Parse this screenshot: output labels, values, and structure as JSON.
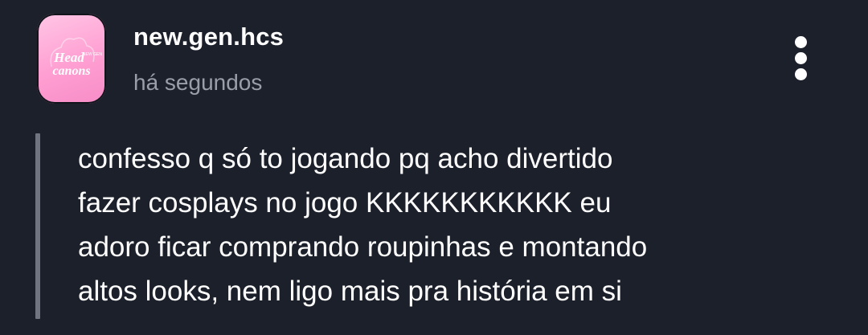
{
  "post": {
    "author": "new.gen.hcs",
    "timestamp": "há segundos",
    "avatar": {
      "logo_top": "Head",
      "logo_bottom": "canons",
      "logo_small": "NEW GEN",
      "colors": {
        "bg": "#ff9fd2",
        "text": "#ffffff"
      }
    },
    "more_icon": "vertical-ellipsis-icon",
    "quote_lines": [
      "confesso q só to jogando pq acho divertido",
      "fazer cosplays no jogo KKKKKKKKKKK eu",
      "adoro ficar comprando roupinhas e montando",
      "altos looks, nem ligo mais pra história em si"
    ]
  },
  "theme": {
    "background": "#1c202b",
    "text": "#ffffff",
    "muted": "#9a9ea8",
    "quote_bar": "#6f7480"
  }
}
